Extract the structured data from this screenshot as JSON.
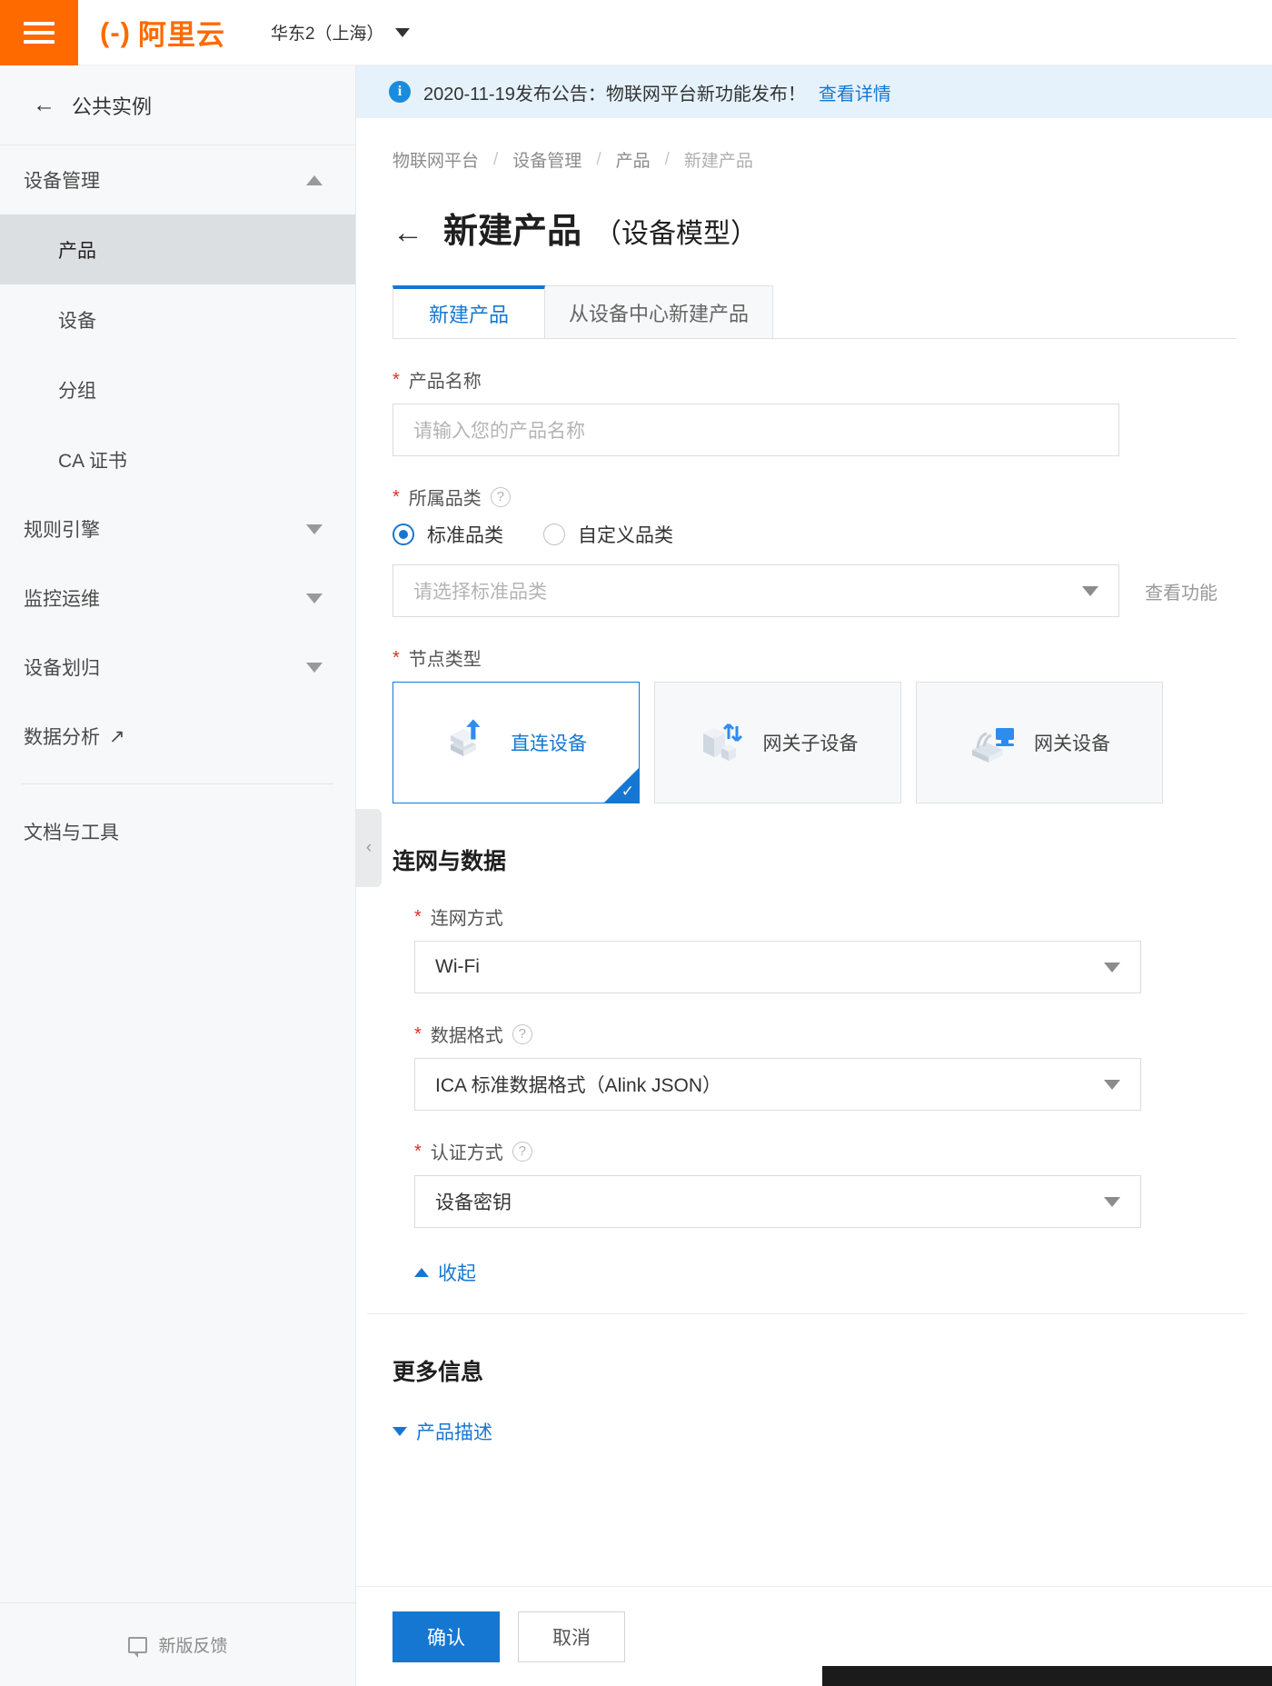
{
  "topbar": {
    "menu_icon": "hamburger-icon",
    "logo_text": "阿里云",
    "logo_mark": "(-)",
    "region": "华东2（上海）"
  },
  "sidebar": {
    "back_label": "公共实例",
    "groups": [
      {
        "label": "设备管理",
        "expanded": true,
        "chevron": "up"
      },
      {
        "label": "规则引擎",
        "expanded": false,
        "chevron": "down"
      },
      {
        "label": "监控运维",
        "expanded": false,
        "chevron": "down"
      },
      {
        "label": "设备划归",
        "expanded": false,
        "chevron": "down"
      }
    ],
    "items": [
      {
        "label": "产品",
        "active": true
      },
      {
        "label": "设备",
        "active": false
      },
      {
        "label": "分组",
        "active": false
      },
      {
        "label": "CA 证书",
        "active": false
      }
    ],
    "data_analysis": {
      "label": "数据分析",
      "external": "↗"
    },
    "docs_tools": "文档与工具",
    "feedback": "新版反馈",
    "collapse_handle": "‹"
  },
  "notice": {
    "text": "2020-11-19发布公告：物联网平台新功能发布！",
    "link": "查看详情"
  },
  "breadcrumb": [
    "物联网平台",
    "设备管理",
    "产品",
    "新建产品"
  ],
  "page": {
    "back_arrow": "←",
    "title": "新建产品",
    "subtitle": "（设备模型）"
  },
  "tabs": [
    {
      "label": "新建产品",
      "active": true
    },
    {
      "label": "从设备中心新建产品",
      "active": false
    }
  ],
  "form": {
    "product_name": {
      "label": "产品名称",
      "required": true,
      "value": "",
      "placeholder": "请输入您的产品名称"
    },
    "category": {
      "label": "所属品类",
      "required": true,
      "help": "?",
      "options": [
        {
          "label": "标准品类",
          "selected": true
        },
        {
          "label": "自定义品类",
          "selected": false
        }
      ],
      "select_placeholder": "请选择标准品类",
      "select_value": "",
      "view_features": "查看功能"
    },
    "node_type": {
      "label": "节点类型",
      "required": true,
      "cards": [
        {
          "label": "直连设备",
          "selected": true,
          "icon": "direct-device-icon"
        },
        {
          "label": "网关子设备",
          "selected": false,
          "icon": "gateway-subdevice-icon"
        },
        {
          "label": "网关设备",
          "selected": false,
          "icon": "gateway-device-icon"
        }
      ]
    },
    "network_section": {
      "title": "连网与数据",
      "net_type": {
        "label": "连网方式",
        "required": true,
        "value": "Wi-Fi"
      },
      "data_format": {
        "label": "数据格式",
        "required": true,
        "help": "?",
        "value": "ICA 标准数据格式（Alink JSON）"
      },
      "auth_type": {
        "label": "认证方式",
        "required": true,
        "help": "?",
        "value": "设备密钥"
      },
      "collapse_label": "收起"
    },
    "more_section": {
      "title": "更多信息",
      "product_desc_label": "产品描述"
    }
  },
  "footer": {
    "confirm": "确认",
    "cancel": "取消"
  },
  "colors": {
    "brand_orange": "#ff6a00",
    "accent_blue": "#1677d2",
    "required_red": "#d93026",
    "notice_bg": "#e6f2fb"
  }
}
